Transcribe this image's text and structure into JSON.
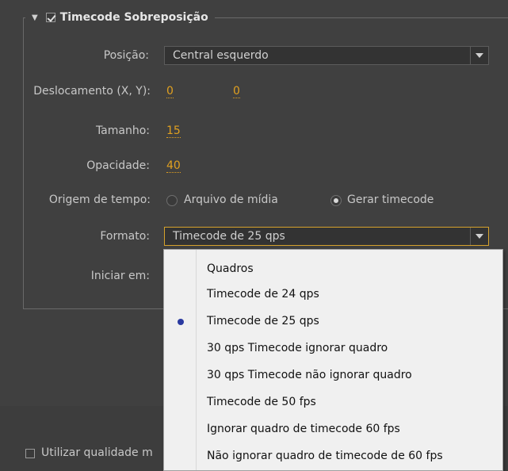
{
  "group": {
    "title": "Timecode Sobreposição",
    "enabled": true
  },
  "fields": {
    "posicao": {
      "label": "Posição:",
      "value": "Central esquerdo"
    },
    "deslocamento": {
      "label": "Deslocamento (X, Y):",
      "x": "0",
      "y": "0"
    },
    "tamanho": {
      "label": "Tamanho:",
      "value": "15"
    },
    "opacidade": {
      "label": "Opacidade:",
      "value": "40"
    },
    "origem": {
      "label": "Origem de tempo:",
      "options": [
        "Arquivo de mídia",
        "Gerar timecode"
      ],
      "selected": "Gerar timecode"
    },
    "formato": {
      "label": "Formato:",
      "value": "Timecode de 25 qps"
    },
    "iniciar": {
      "label": "Iniciar em:"
    }
  },
  "bottom": {
    "checkbox_label": "Utilizar qualidade m",
    "checked": false
  },
  "menu": {
    "items": [
      "Quadros",
      "Timecode de 24 qps",
      "Timecode de 25 qps",
      "30 qps Timecode ignorar quadro",
      "30 qps Timecode não ignorar quadro",
      "Timecode de 50 fps",
      "Ignorar quadro de timecode 60 fps",
      "Não ignorar quadro de timecode de 60 fps"
    ],
    "selected": "Timecode de 25 qps"
  },
  "colors": {
    "accent_value": "#e0a020",
    "focus_border": "#d6a22c",
    "bullet": "#2a3aa0"
  }
}
